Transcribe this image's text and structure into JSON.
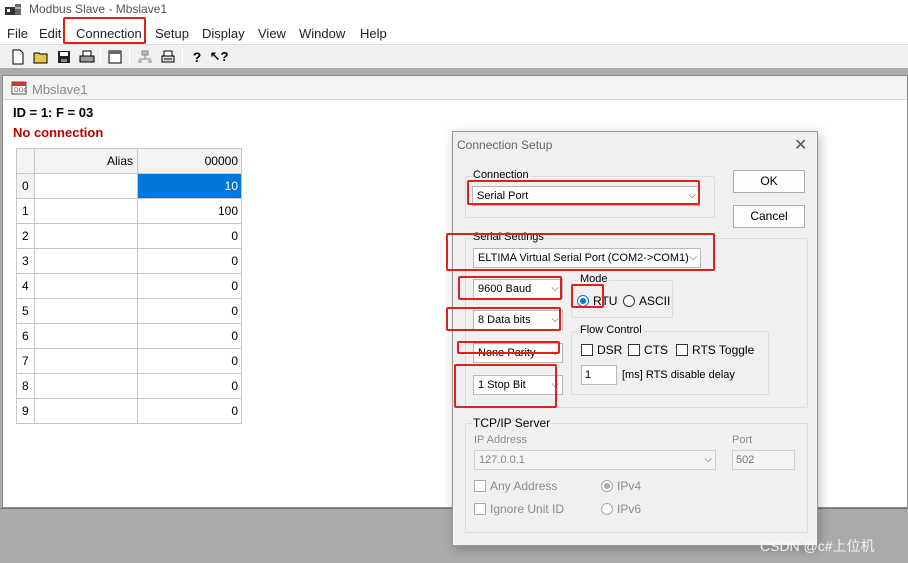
{
  "window": {
    "title": "Modbus Slave - Mbslave1"
  },
  "menu": [
    "File",
    "Edit",
    "Connection",
    "Setup",
    "Display",
    "View",
    "Window",
    "Help"
  ],
  "toolbar": {
    "icons": [
      "new-file-icon",
      "open-folder-icon",
      "save-icon",
      "print-icon",
      "window-icon",
      "network-icon",
      "printer-icon",
      "help-icon",
      "context-help-icon"
    ]
  },
  "child": {
    "title": "Mbslave1",
    "id_line": "ID = 1: F = 03",
    "status": "No connection",
    "grid": {
      "headers": [
        "",
        "Alias",
        "00000"
      ],
      "rows": [
        {
          "idx": "0",
          "alias": "",
          "value": "10"
        },
        {
          "idx": "1",
          "alias": "",
          "value": "100"
        },
        {
          "idx": "2",
          "alias": "",
          "value": "0"
        },
        {
          "idx": "3",
          "alias": "",
          "value": "0"
        },
        {
          "idx": "4",
          "alias": "",
          "value": "0"
        },
        {
          "idx": "5",
          "alias": "",
          "value": "0"
        },
        {
          "idx": "6",
          "alias": "",
          "value": "0"
        },
        {
          "idx": "7",
          "alias": "",
          "value": "0"
        },
        {
          "idx": "8",
          "alias": "",
          "value": "0"
        },
        {
          "idx": "9",
          "alias": "",
          "value": "0"
        }
      ]
    }
  },
  "dialog": {
    "title": "Connection Setup",
    "connection_label": "Connection",
    "connection_value": "Serial Port",
    "ok_label": "OK",
    "cancel_label": "Cancel",
    "serial_settings_label": "Serial Settings",
    "port_value": "ELTIMA Virtual Serial Port (COM2->COM1)",
    "baud_value": "9600 Baud",
    "databits_value": "8 Data bits",
    "parity_value": "None Parity",
    "stopbit_value": "1 Stop Bit",
    "mode_label": "Mode",
    "mode_rtu": "RTU",
    "mode_ascii": "ASCII",
    "flow_label": "Flow Control",
    "flow_dsr": "DSR",
    "flow_cts": "CTS",
    "flow_rts_toggle": "RTS Toggle",
    "rts_delay_value": "1",
    "rts_delay_label": "[ms] RTS disable delay",
    "tcp_label": "TCP/IP Server",
    "ip_label": "IP Address",
    "ip_value": "127.0.0.1",
    "port_label": "Port",
    "port_num": "502",
    "any_address": "Any Address",
    "ignore_unit_id": "Ignore Unit ID",
    "ipv4": "IPv4",
    "ipv6": "IPv6"
  },
  "watermark": "CSDN @c#上位机",
  "colors": {
    "selection": "#0078d7",
    "error_text": "#c00000",
    "annotation": "#e0201c"
  }
}
